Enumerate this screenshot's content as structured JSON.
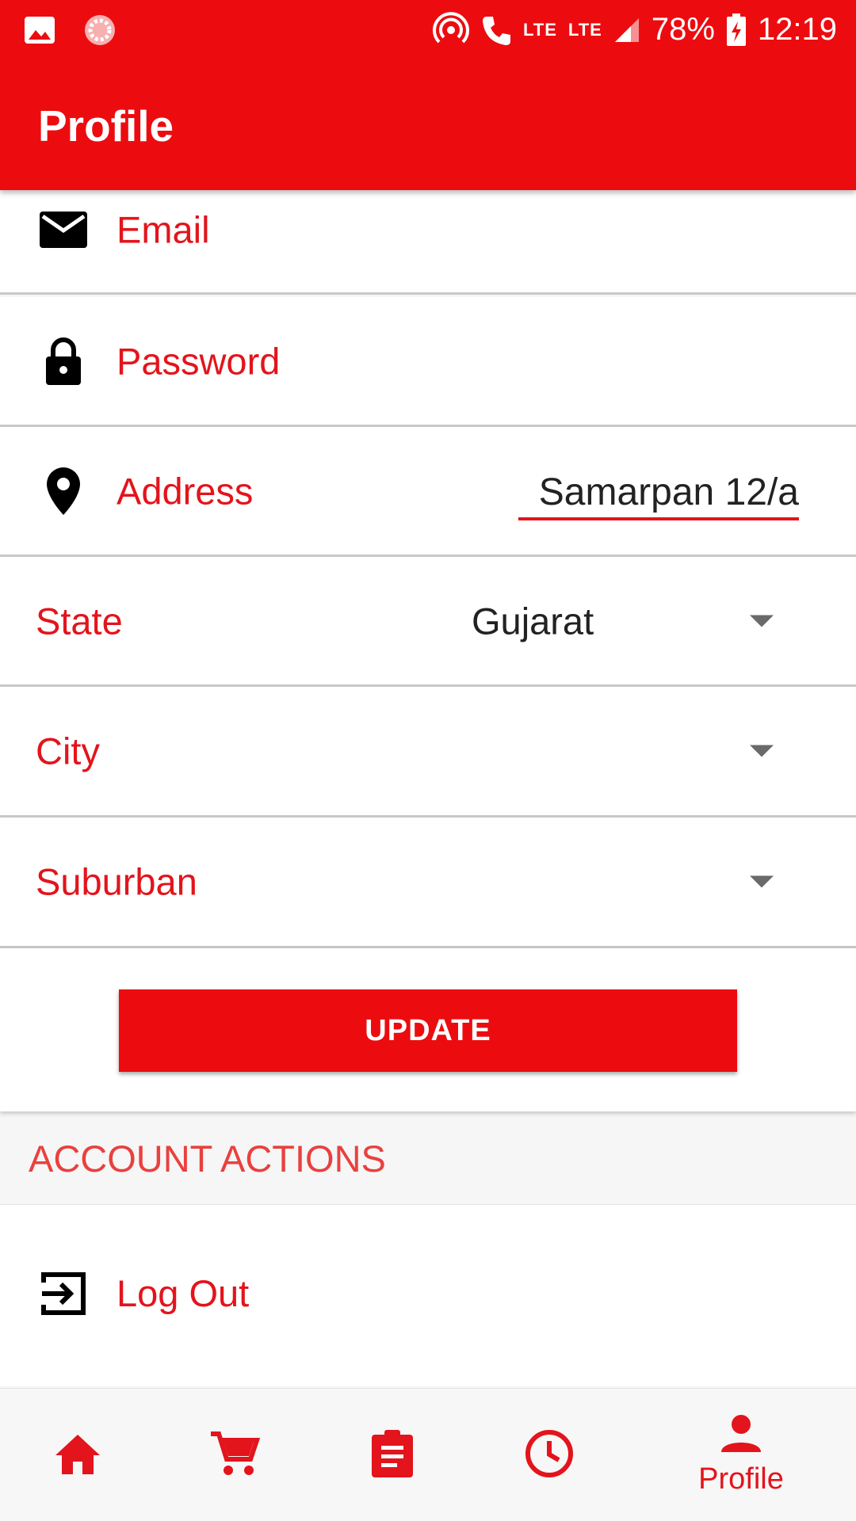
{
  "status_bar": {
    "battery": "78%",
    "time": "12:19",
    "network_1": "LTE",
    "network_2": "LTE",
    "icons": [
      "image-icon",
      "app-loader-icon",
      "hotspot-icon",
      "volte-call-icon",
      "signal-icon",
      "battery-charging-icon"
    ]
  },
  "app_bar": {
    "title": "Profile"
  },
  "form": {
    "email_label": "Email",
    "password_label": "Password",
    "address_label": "Address",
    "address_value": "Samarpan 12/a",
    "state_label": "State",
    "state_value": "Gujarat",
    "city_label": "City",
    "suburban_label": "Suburban",
    "update_label": "UPDATE"
  },
  "account_actions": {
    "header": "ACCOUNT ACTIONS",
    "logout_label": "Log Out"
  },
  "bottom_nav": {
    "items": [
      "home-icon",
      "cart-icon",
      "orders-icon",
      "history-icon",
      "profile-icon"
    ],
    "active_label": "Profile"
  },
  "colors": {
    "brand_red": "#ec0c10",
    "label_red": "#e3141c"
  }
}
